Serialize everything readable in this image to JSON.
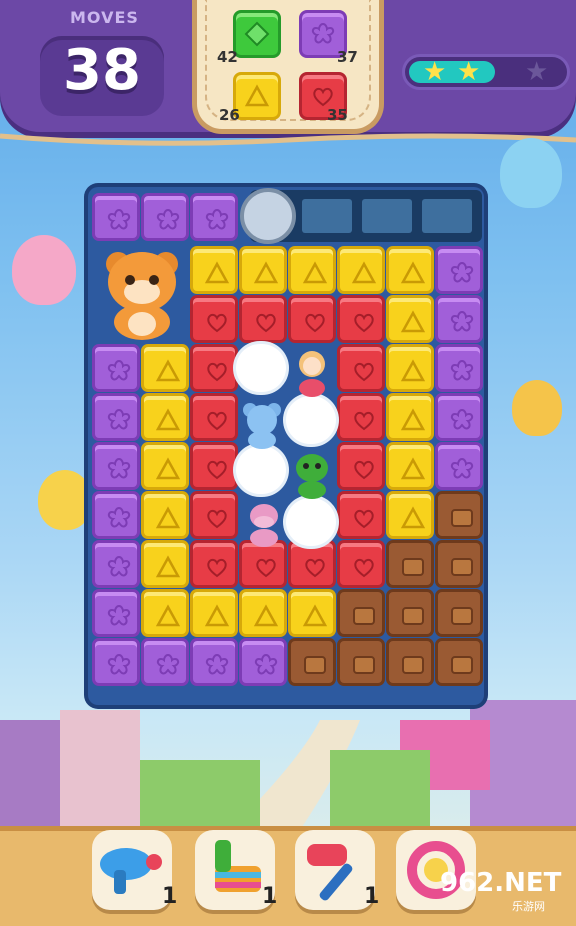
{
  "hud": {
    "moves_label": "MOVES",
    "moves_value": "38",
    "goals": [
      {
        "color": "green",
        "shape": "diamond-icon",
        "count": "42"
      },
      {
        "color": "purple",
        "shape": "flower-icon",
        "count": "37"
      },
      {
        "color": "yellow",
        "shape": "triangle-icon",
        "count": "26"
      },
      {
        "color": "red",
        "shape": "heart-icon",
        "count": "35"
      }
    ],
    "stars_earned": 2,
    "stars_total": 3
  },
  "boosters": [
    {
      "name": "blaster",
      "count": "1"
    },
    {
      "name": "pinata",
      "count": "1"
    },
    {
      "name": "hammer",
      "count": "1"
    },
    {
      "name": "spin-ring",
      "count": ""
    }
  ],
  "watermark": {
    "main": "962.NET",
    "sub": "乐游网"
  },
  "colors": {
    "purple": "#a15fd9",
    "yellow": "#f8d21c",
    "red": "#e73c46",
    "green": "#3ec93c",
    "hud": "#6c48a6",
    "board": "#2d5aa0"
  }
}
